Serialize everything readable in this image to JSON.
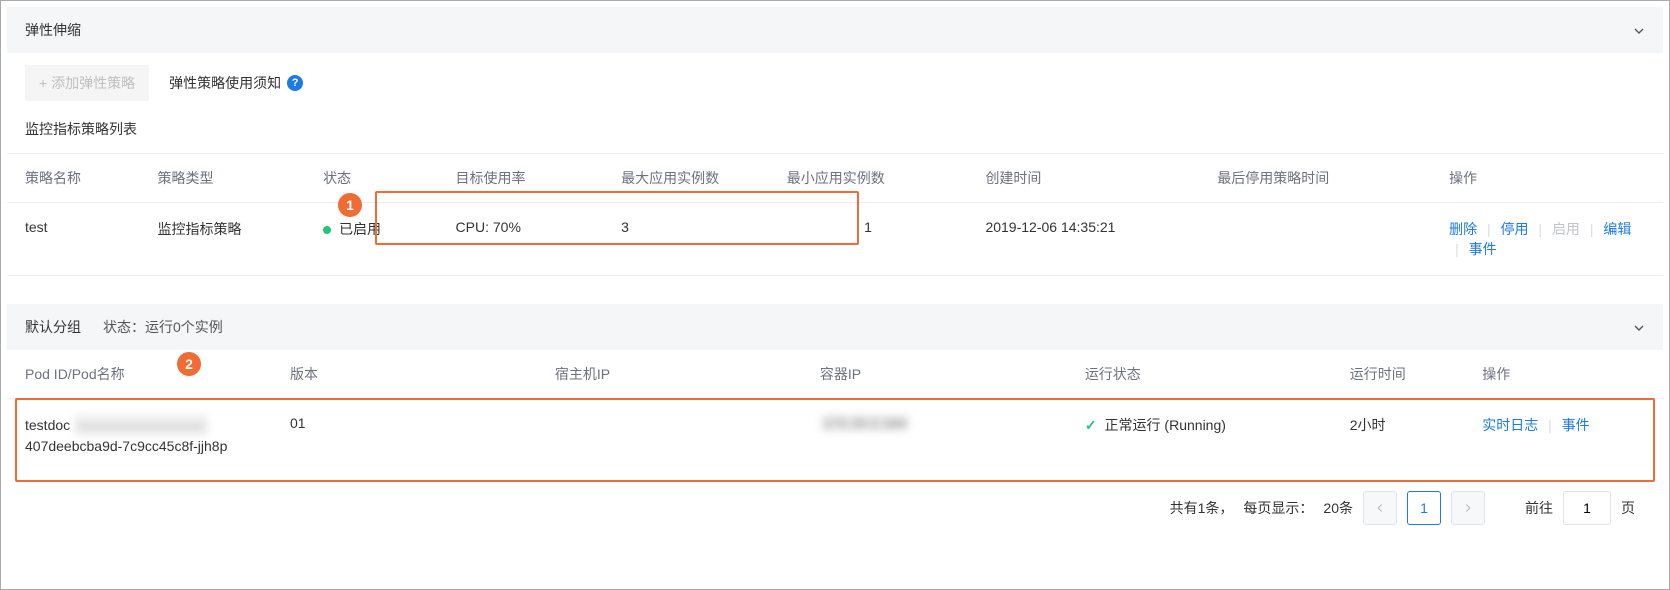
{
  "section1": {
    "title": "弹性伸缩",
    "add_button": "+ 添加弹性策略",
    "hint_text": "弹性策略使用须知",
    "subhead": "监控指标策略列表"
  },
  "policy_table": {
    "headers": {
      "name": "策略名称",
      "type": "策略类型",
      "state": "状态",
      "util": "目标使用率",
      "max": "最大应用实例数",
      "min": "最小应用实例数",
      "created": "创建时间",
      "last_disabled": "最后停用策略时间",
      "ops": "操作"
    },
    "row": {
      "name": "test",
      "type": "监控指标策略",
      "state": "已启用",
      "util": "CPU: 70%",
      "max": "3",
      "min": "1",
      "created": "2019-12-06 14:35:21",
      "last_disabled": "",
      "ops": {
        "delete": "删除",
        "stop": "停用",
        "start": "启用",
        "edit": "编辑",
        "events": "事件"
      }
    }
  },
  "callouts": {
    "one": "1",
    "two": "2"
  },
  "panel2": {
    "group": "默认分组",
    "state_label": "状态：",
    "state_value": "运行0个实例"
  },
  "pod_table": {
    "headers": {
      "id": "Pod ID/Pod名称",
      "version": "版本",
      "host_ip": "宿主机IP",
      "container_ip": "容器IP",
      "run_state": "运行状态",
      "runtime": "运行时间",
      "ops": "操作"
    },
    "row": {
      "id_line1_prefix": "testdoc",
      "id_line1_obscured": "—————————",
      "id_line2": "407deebcba9d-7c9cc45c8f-jjh8p",
      "version": "01",
      "host_ip": "",
      "container_ip_obscured": "172.20.2.164",
      "run_state": "正常运行 (Running)",
      "runtime": "2小时",
      "ops": {
        "logs": "实时日志",
        "events": "事件"
      }
    }
  },
  "pagination": {
    "total_prefix": "共有",
    "total_count": "1",
    "total_suffix": "条，",
    "per_page_label": "每页显示：",
    "per_page_value": "20条",
    "page": "1",
    "goto_label": "前往",
    "goto_value": "1",
    "page_suffix": "页"
  }
}
